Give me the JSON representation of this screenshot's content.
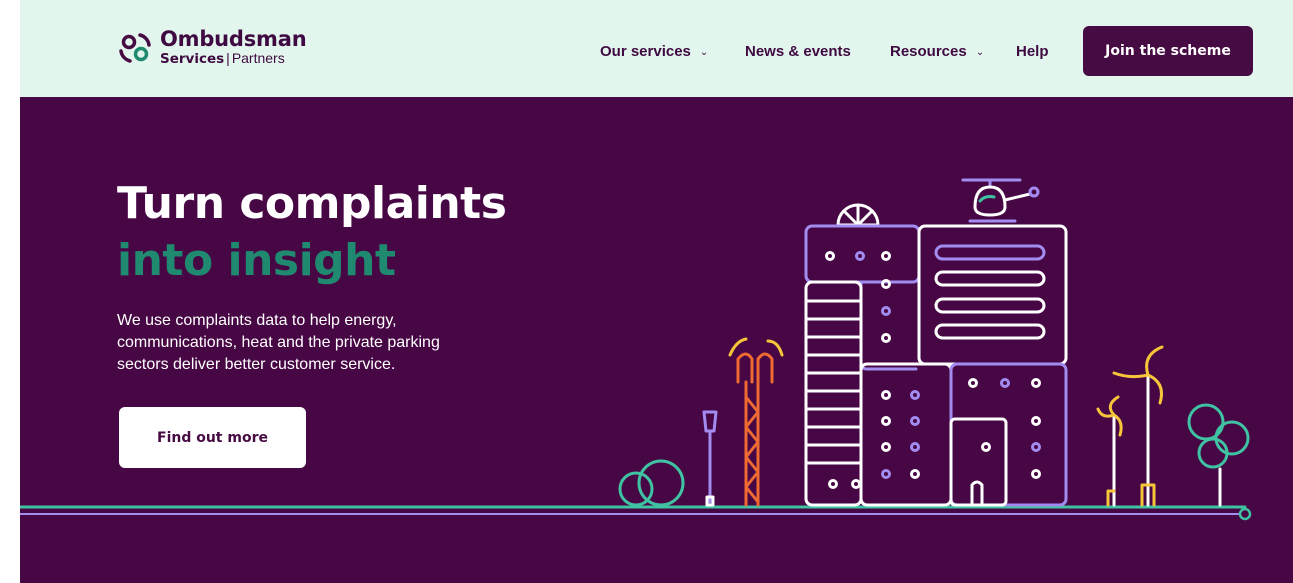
{
  "brand": {
    "name_line1": "Ombudsman",
    "name_line2_bold": "Services",
    "name_line2_sep": "|",
    "name_line2_rest": "Partners",
    "colors": {
      "plum": "#470744",
      "mint": "#e3f6ee",
      "green": "#1f8a6f",
      "teal": "#3fc3a2",
      "lilac": "#a38cf0",
      "orange": "#ef6a32",
      "yellow": "#f7c53a"
    }
  },
  "nav": {
    "items": [
      {
        "label": "Our services",
        "has_dropdown": true,
        "icon": "chevron-down-icon"
      },
      {
        "label": "News & events",
        "has_dropdown": false
      },
      {
        "label": "Resources",
        "has_dropdown": true,
        "icon": "chevron-down-icon"
      },
      {
        "label": "Help",
        "has_dropdown": false
      }
    ],
    "cta_label": "Join the scheme",
    "chevron": "⌄"
  },
  "hero": {
    "title_line1": "Turn complaints",
    "title_line2": "into insight",
    "description": "We use complaints data to help energy, communications, heat and the private parking sectors deliver better customer service.",
    "button_label": "Find out more"
  }
}
